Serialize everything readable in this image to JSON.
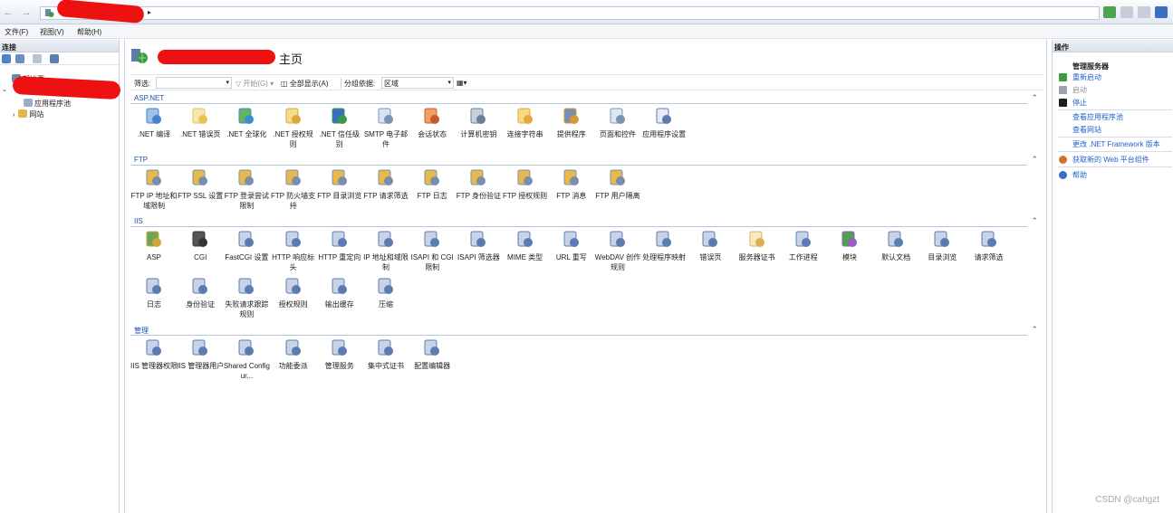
{
  "menu": [
    {
      "label": "文件(F)"
    },
    {
      "label": "视图(V)"
    },
    {
      "label": "帮助(H)"
    }
  ],
  "left": {
    "header": "连接",
    "tree": [
      {
        "label": "起始页"
      },
      {
        "label": "应用程序池"
      },
      {
        "label": "网站"
      }
    ]
  },
  "center": {
    "title": "主页",
    "filter": {
      "label": "筛选:",
      "start": "开始(G)",
      "showall": "全部显示(A)",
      "groupby": "分组依据:",
      "groupvalue": "区域"
    },
    "sections": [
      {
        "name": "ASP.NET",
        "items": [
          {
            "label": ".NET 编译",
            "icon": "dotnet-compile-icon"
          },
          {
            "label": ".NET 错误页",
            "icon": "error-page-icon"
          },
          {
            "label": ".NET 全球化",
            "icon": "globe-icon"
          },
          {
            "label": ".NET 授权规则",
            "icon": "lock-icon"
          },
          {
            "label": ".NET 信任级别",
            "icon": "trust-icon"
          },
          {
            "label": "SMTP 电子邮件",
            "icon": "smtp-icon"
          },
          {
            "label": "会话状态",
            "icon": "session-icon"
          },
          {
            "label": "计算机密钥",
            "icon": "machine-key-icon"
          },
          {
            "label": "连接字符串",
            "icon": "connection-string-icon"
          },
          {
            "label": "提供程序",
            "icon": "providers-icon"
          },
          {
            "label": "页面和控件",
            "icon": "pages-controls-icon"
          },
          {
            "label": "应用程序设置",
            "icon": "app-settings-icon"
          }
        ]
      },
      {
        "name": "FTP",
        "items": [
          {
            "label": "FTP IP 地址和域限制",
            "icon": "ftp-ip-icon"
          },
          {
            "label": "FTP SSL 设置",
            "icon": "ftp-ssl-icon"
          },
          {
            "label": "FTP 登录尝试限制",
            "icon": "ftp-logon-icon"
          },
          {
            "label": "FTP 防火墙支持",
            "icon": "ftp-firewall-icon"
          },
          {
            "label": "FTP 目录浏览",
            "icon": "ftp-dir-icon"
          },
          {
            "label": "FTP 请求筛选",
            "icon": "ftp-filter-icon"
          },
          {
            "label": "FTP 日志",
            "icon": "ftp-log-icon"
          },
          {
            "label": "FTP 身份验证",
            "icon": "ftp-auth-icon"
          },
          {
            "label": "FTP 授权规则",
            "icon": "ftp-authz-icon"
          },
          {
            "label": "FTP 消息",
            "icon": "ftp-message-icon"
          },
          {
            "label": "FTP 用户隔离",
            "icon": "ftp-isolation-icon"
          }
        ]
      },
      {
        "name": "IIS",
        "items": [
          {
            "label": "ASP",
            "icon": "asp-icon"
          },
          {
            "label": "CGI",
            "icon": "cgi-icon"
          },
          {
            "label": "FastCGI 设置",
            "icon": "fastcgi-icon"
          },
          {
            "label": "HTTP 响应标头",
            "icon": "http-headers-icon"
          },
          {
            "label": "HTTP 重定向",
            "icon": "http-redirect-icon"
          },
          {
            "label": "IP 地址和域限制",
            "icon": "ip-restrict-icon"
          },
          {
            "label": "ISAPI 和 CGI 限制",
            "icon": "isapi-cgi-icon"
          },
          {
            "label": "ISAPI 筛选器",
            "icon": "isapi-filter-icon"
          },
          {
            "label": "MIME 类型",
            "icon": "mime-icon"
          },
          {
            "label": "URL 重写",
            "icon": "url-rewrite-icon"
          },
          {
            "label": "WebDAV 创作规则",
            "icon": "webdav-icon"
          },
          {
            "label": "处理程序映射",
            "icon": "handler-icon"
          },
          {
            "label": "错误页",
            "icon": "error-pages-icon"
          },
          {
            "label": "服务器证书",
            "icon": "certificate-icon"
          },
          {
            "label": "工作进程",
            "icon": "worker-process-icon"
          },
          {
            "label": "模块",
            "icon": "modules-icon"
          },
          {
            "label": "默认文档",
            "icon": "default-doc-icon"
          },
          {
            "label": "目录浏览",
            "icon": "dir-browse-icon"
          },
          {
            "label": "请求筛选",
            "icon": "request-filter-icon"
          },
          {
            "label": "日志",
            "icon": "logging-icon"
          },
          {
            "label": "身份验证",
            "icon": "authentication-icon"
          },
          {
            "label": "失败请求跟踪规则",
            "icon": "failed-request-icon"
          },
          {
            "label": "授权规则",
            "icon": "authorization-icon"
          },
          {
            "label": "输出缓存",
            "icon": "output-cache-icon"
          },
          {
            "label": "压缩",
            "icon": "compression-icon"
          }
        ]
      },
      {
        "name": "管理",
        "items": [
          {
            "label": "IIS 管理器权限",
            "icon": "mgr-permissions-icon"
          },
          {
            "label": "IIS 管理器用户",
            "icon": "mgr-users-icon"
          },
          {
            "label": "Shared Configur...",
            "icon": "shared-config-icon"
          },
          {
            "label": "功能委派",
            "icon": "feature-delegation-icon"
          },
          {
            "label": "管理服务",
            "icon": "mgmt-service-icon"
          },
          {
            "label": "集中式证书",
            "icon": "central-cert-icon"
          },
          {
            "label": "配置编辑器",
            "icon": "config-editor-icon"
          }
        ]
      }
    ]
  },
  "right": {
    "header": "操作",
    "group": "管理服务器",
    "actions": [
      {
        "label": "重新启动",
        "state": "enabled",
        "icon": "restart-icon"
      },
      {
        "label": "启动",
        "state": "disabled",
        "icon": "start-icon"
      },
      {
        "label": "停止",
        "state": "enabled",
        "icon": "stop-icon"
      },
      {
        "label": "查看应用程序池",
        "state": "enabled",
        "icon": ""
      },
      {
        "label": "查看网站",
        "state": "enabled",
        "icon": ""
      },
      {
        "label": "更改 .NET Framework 版本",
        "state": "enabled",
        "icon": ""
      },
      {
        "label": "获取新的 Web 平台组件",
        "state": "enabled",
        "icon": "web-platform-icon"
      },
      {
        "label": "帮助",
        "state": "enabled",
        "icon": "help-icon"
      }
    ]
  },
  "watermark": "CSDN @cahgzt",
  "colors": {
    "link": "#1f5fcf",
    "section": "#1f50b3",
    "accent_red": "#ee1111"
  }
}
